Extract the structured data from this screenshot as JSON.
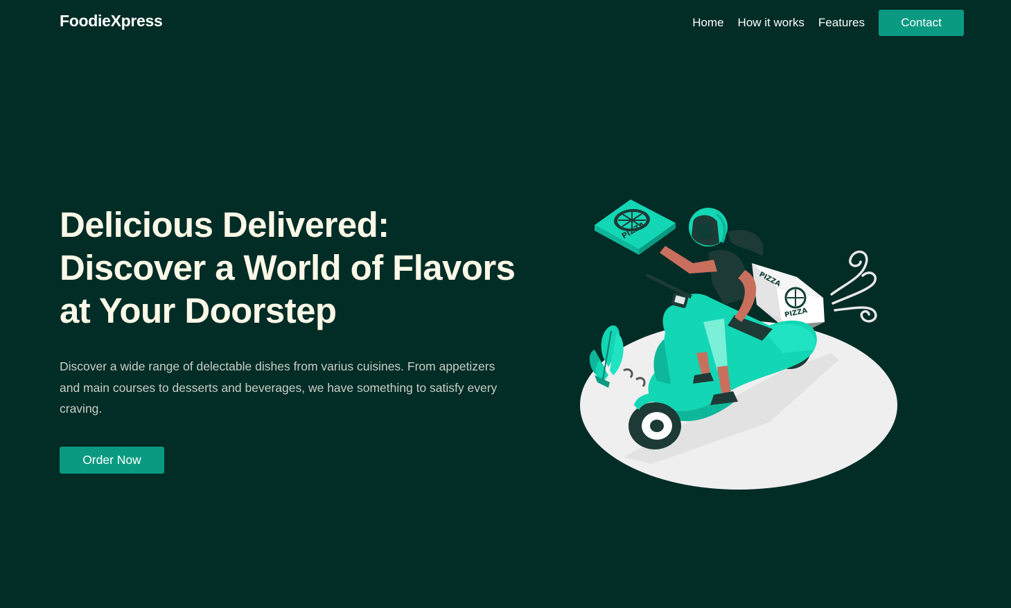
{
  "nav": {
    "brand": "FoodieXpress",
    "links": [
      "Home",
      "How it works",
      "Features"
    ],
    "contact_label": "Contact"
  },
  "hero": {
    "title_lines": [
      "Delicious Delivered:",
      "Discover a World of Flavors",
      "at Your Doorstep"
    ],
    "description": "Discover a wide range of delectable dishes from varius cuisines. From appetizers and main courses to desserts and beverages, we have something to satisfy every craving.",
    "cta_label": "Order Now"
  },
  "illustration": {
    "subject": "delivery-scooter-rider-with-pizza",
    "box_text": "PIZZA",
    "delivery_box_text": "PIZZA"
  },
  "colors": {
    "background": "#022c26",
    "accent": "#0a9a82",
    "heading": "#fbf8e7",
    "body_text": "#c9cfc7",
    "scooter": "#13d6b4"
  }
}
